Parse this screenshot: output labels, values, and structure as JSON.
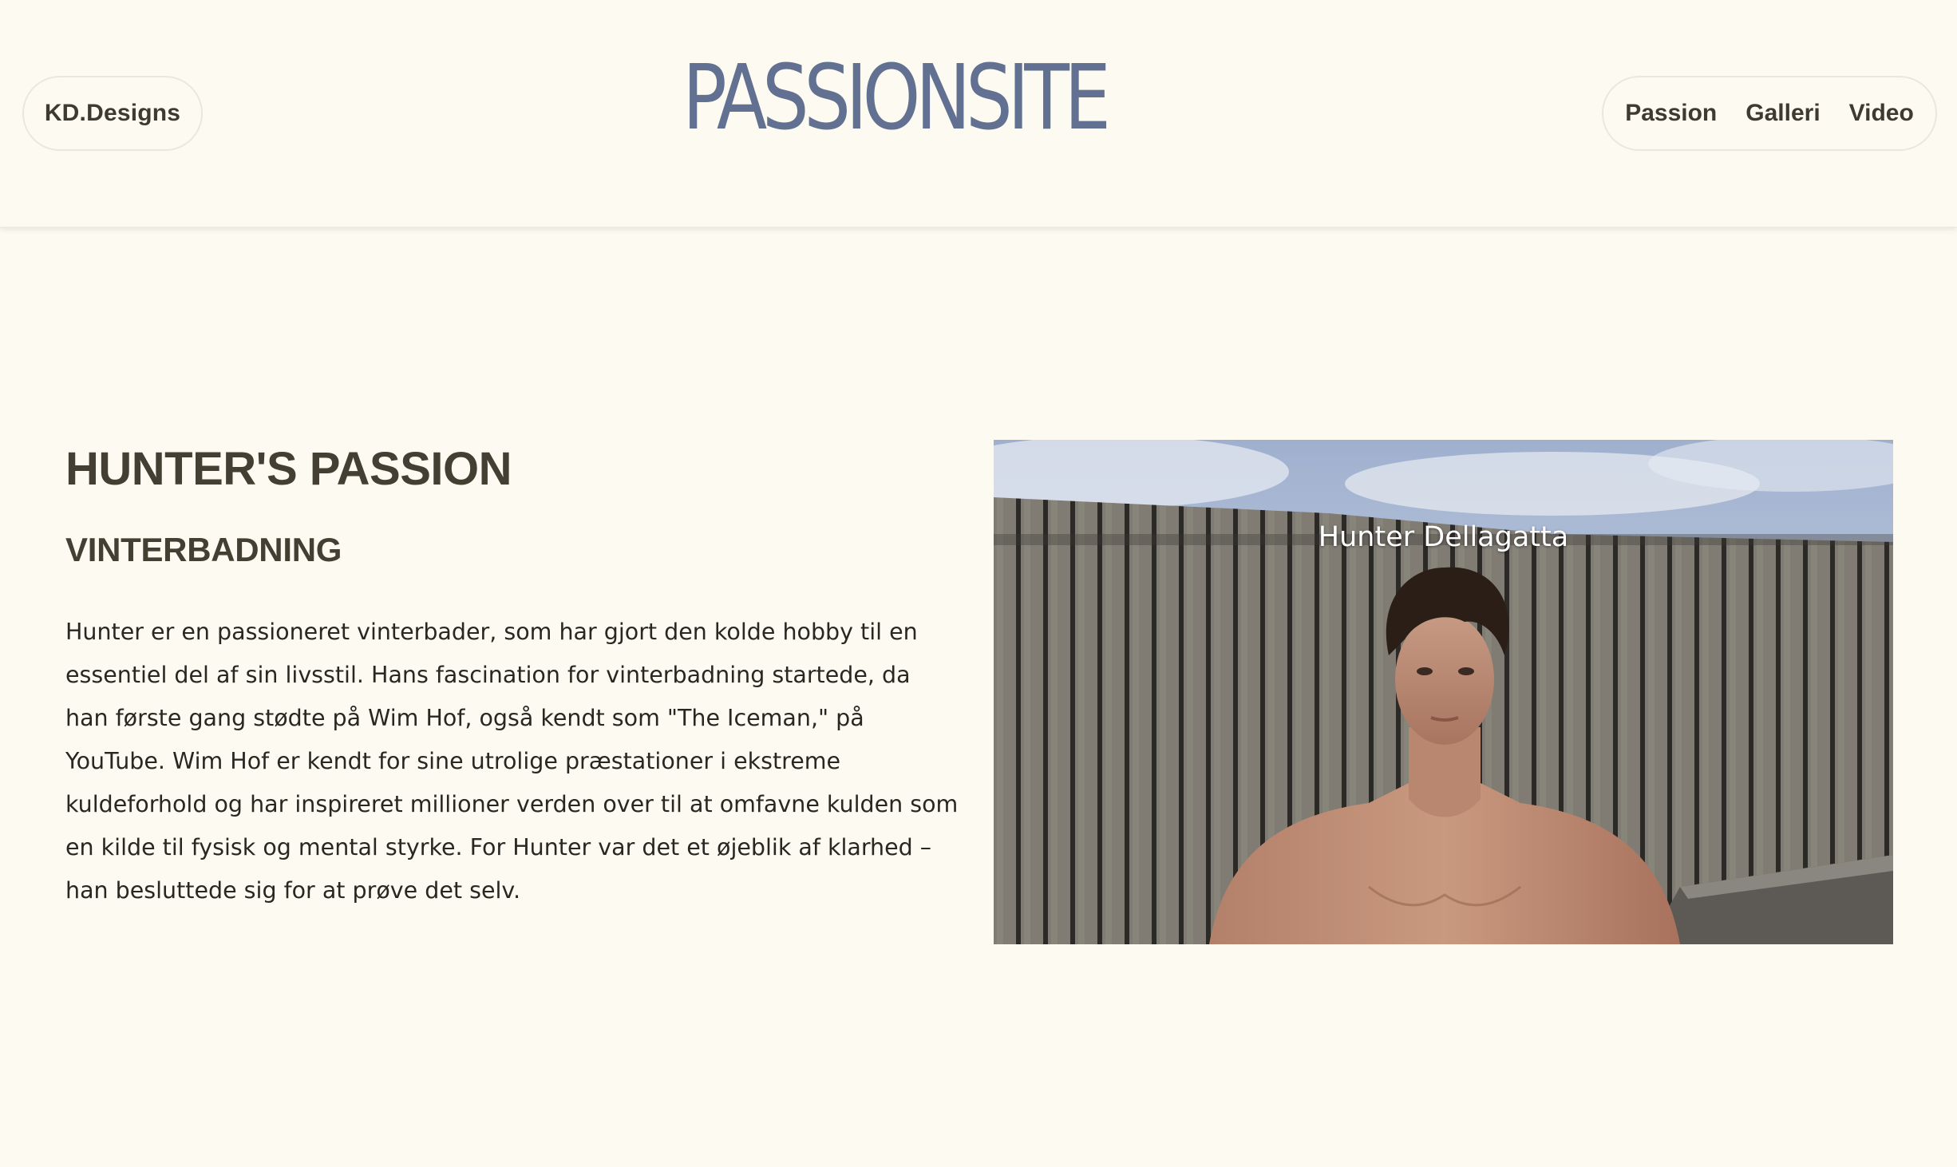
{
  "header": {
    "brand": "KD.Designs",
    "logo": "PASSIONSITE",
    "nav": [
      {
        "label": "Passion"
      },
      {
        "label": "Galleri"
      },
      {
        "label": "Video"
      }
    ]
  },
  "main": {
    "title": "HUNTER'S PASSION",
    "subtitle": "VINTERBADNING",
    "body": "Hunter er en passioneret vinterbader, som har gjort den kolde hobby til en essentiel del af sin livsstil. Hans fascination for vinterbadning startede, da han første gang stødte på Wim Hof, også kendt som \"The Iceman,\" på YouTube. Wim Hof er kendt for sine utrolige præstationer i ekstreme kuldeforhold og har inspireret millioner verden over til at omfavne kulden som en kilde til fysisk og mental styrke. For Hunter var det et øjeblik af klarhed – han besluttede sig for at prøve det selv.",
    "photo": {
      "caption": "Hunter Dellagatta"
    }
  },
  "colors": {
    "background": "#fdfbf1",
    "text": "#443f33",
    "logo": "#5a6a8c",
    "pill_border": "#ebe7dc"
  }
}
